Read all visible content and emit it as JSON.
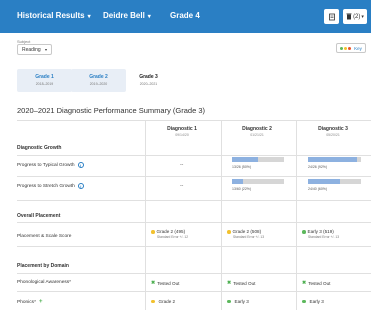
{
  "header": {
    "results_label": "Historical Results",
    "student_name": "Deidre Bell",
    "grade": "Grade 4",
    "print_icon": "print-icon",
    "trash_count": "(2)"
  },
  "subject": {
    "label": "Subject",
    "value": "Reading"
  },
  "key_label": "Key",
  "year_tabs": [
    {
      "grade": "Grade 1",
      "years": "2018–2019"
    },
    {
      "grade": "Grade 2",
      "years": "2019–2020"
    },
    {
      "grade": "Grade 3",
      "years": "2020–2021"
    }
  ],
  "summary_title": "2020–2021 Diagnostic Performance Summary (Grade 3)",
  "columns": [
    {
      "title": "Diagnostic 1",
      "date": "09/14/20"
    },
    {
      "title": "Diagnostic 2",
      "date": "01/21/21"
    },
    {
      "title": "Diagnostic 3",
      "date": "05/20/21"
    }
  ],
  "sections": {
    "growth": "Diagnostic Growth",
    "placement": "Overall Placement",
    "domain": "Placement by Domain"
  },
  "growth_rows": [
    {
      "label": "Progress to Typical Growth",
      "d1": "--",
      "d2_caption": "13/26 (50%)",
      "d2_fill": 0.5,
      "d3_caption": "24/26 (92%)",
      "d3_fill": 0.92
    },
    {
      "label": "Progress to Stretch Growth",
      "d1": "--",
      "d2_caption": "13/60 (22%)",
      "d2_fill": 0.22,
      "d3_caption": "24/40 (60%)",
      "d3_fill": 0.6
    }
  ],
  "placement_row": {
    "label": "Placement & Scale Score",
    "cells": [
      {
        "text": "Grade 2 (495)",
        "sub": "Standard Error +/- 12",
        "color": "#f2c12e"
      },
      {
        "text": "Grade 2 (508)",
        "sub": "Standard Error +/- 13",
        "color": "#f2c12e"
      },
      {
        "text": "Early 3 (519)",
        "sub": "Standard Error +/- 13",
        "color": "#5cb85c"
      }
    ]
  },
  "domain_rows": [
    {
      "label": "Phonological Awareness*",
      "cells": [
        {
          "text": "Tested Out",
          "type": "check"
        },
        {
          "text": "Tested Out",
          "type": "check"
        },
        {
          "text": "Tested Out",
          "type": "check"
        }
      ]
    },
    {
      "label": "Phonics*",
      "cells": [
        {
          "text": "Grade 2",
          "type": "dot",
          "color": "#f2c12e"
        },
        {
          "text": "Early 3",
          "type": "dot",
          "color": "#5cb85c"
        },
        {
          "text": "Early 3",
          "type": "dot",
          "color": "#5cb85c"
        }
      ]
    }
  ],
  "colors": {
    "header_bg": "#2a7fc4",
    "bar_fill": "#8db1e0",
    "yellow": "#f2c12e",
    "green": "#5cb85c"
  }
}
